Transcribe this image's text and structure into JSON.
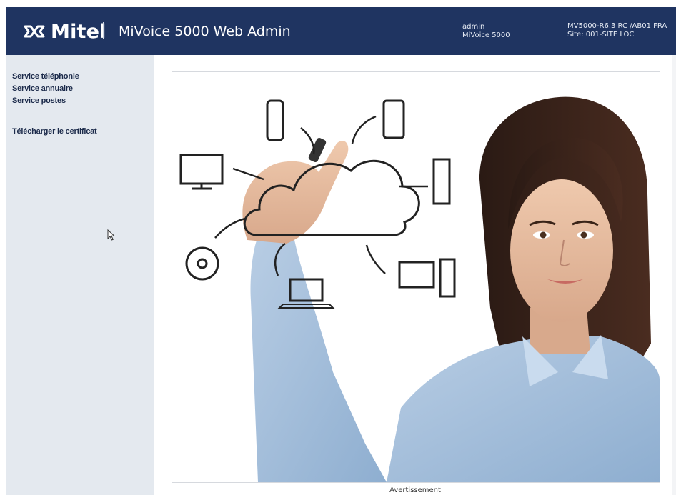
{
  "header": {
    "brand": "Mitel",
    "brand_icon": "mitel-logo-icon",
    "app_title": "MiVoice 5000 Web Admin",
    "user_name": "admin",
    "user_product": "MiVoice 5000",
    "system_version": "MV5000-R6.3 RC /AB01 FRA",
    "system_site": "Site: 001-SITE LOC"
  },
  "sidebar": {
    "items": [
      {
        "label": "Service téléphonie"
      },
      {
        "label": "Service annuaire"
      },
      {
        "label": "Service postes"
      }
    ],
    "certificate_link": "Télécharger le certificat"
  },
  "main": {
    "hero_image": "woman-drawing-cloud-network-image",
    "caption": "Avertissement"
  },
  "colors": {
    "header_bg": "#1f3461",
    "sidebar_bg": "#e4e9ef",
    "nav_text": "#1b2a4a"
  }
}
